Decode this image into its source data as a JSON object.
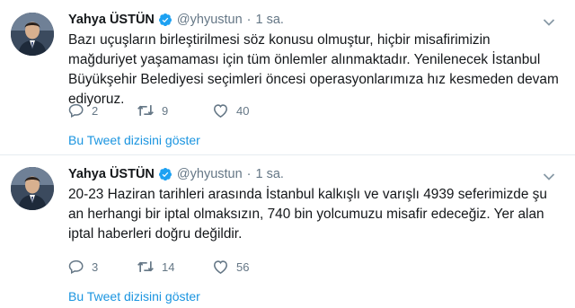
{
  "colors": {
    "link": "#1b95e0",
    "muted": "#657786",
    "text": "#14171a",
    "verified": "#1da1f2",
    "separator": "#e6ecf0"
  },
  "tweets": [
    {
      "author_name": "Yahya ÜSTÜN",
      "handle": "@yhyustun",
      "separator_dot": "·",
      "time": "1 sa.",
      "text": "Bazı uçuşların birleştirilmesi söz konusu olmuştur, hiçbir misafirimizin mağduriyet yaşamaması için tüm önlemler alınmaktadır. Yenilenecek İstanbul Büyükşehir Belediyesi seçimleri öncesi operasyonlarımıza hız kesmeden devam ediyoruz.",
      "reply_count": "2",
      "retweet_count": "9",
      "like_count": "40",
      "thread_link": "Bu Tweet dizisini göster",
      "icons": [
        "avatar",
        "verified-badge-icon",
        "chevron-down-icon",
        "reply-icon",
        "retweet-icon",
        "like-icon"
      ]
    },
    {
      "author_name": "Yahya ÜSTÜN",
      "handle": "@yhyustun",
      "separator_dot": "·",
      "time": "1 sa.",
      "text": "20-23 Haziran tarihleri arasında İstanbul kalkışlı ve varışlı 4939 seferimizde şu an herhangi bir iptal olmaksızın, 740 bin yolcumuzu misafir edeceğiz. Yer alan iptal haberleri doğru değildir.",
      "reply_count": "3",
      "retweet_count": "14",
      "like_count": "56",
      "thread_link": "Bu Tweet dizisini göster",
      "icons": [
        "avatar",
        "verified-badge-icon",
        "chevron-down-icon",
        "reply-icon",
        "retweet-icon",
        "like-icon"
      ]
    }
  ]
}
